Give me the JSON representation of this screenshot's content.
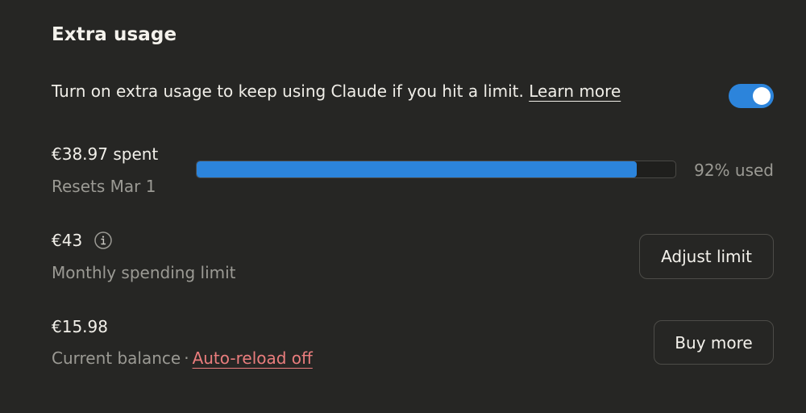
{
  "section": {
    "title": "Extra usage"
  },
  "intro": {
    "text": "Turn on extra usage to keep using Claude if you hit a limit.",
    "learn_more": "Learn more",
    "toggle_on": true
  },
  "usage": {
    "spent": "€38.97 spent",
    "resets": "Resets Mar 1",
    "percent_used": 92,
    "percent_label": "92% used"
  },
  "limit": {
    "amount": "€43",
    "label": "Monthly spending limit",
    "button": "Adjust limit",
    "info_icon": "info-icon"
  },
  "balance": {
    "amount": "€15.98",
    "label": "Current balance",
    "separator": "·",
    "auto_reload": "Auto-reload off",
    "button": "Buy more"
  },
  "colors": {
    "background": "#262624",
    "accent": "#2c84db",
    "auto_reload": "#ea7d7d",
    "muted_text": "#9b9a94"
  }
}
